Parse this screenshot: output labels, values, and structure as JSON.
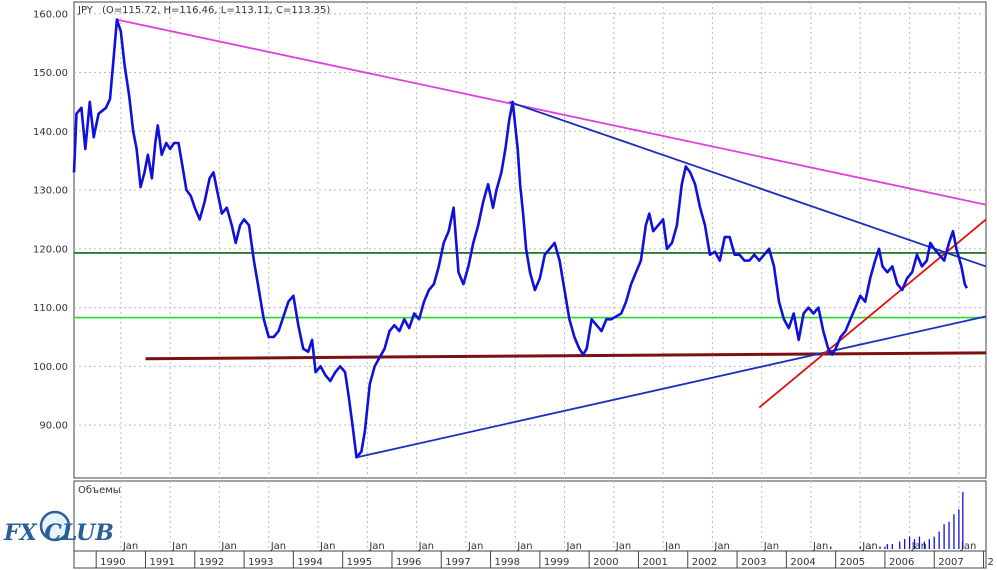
{
  "header": {
    "symbol": "JPY",
    "ohlc": "(O=115.72, H=116.46, L=113.11, C=113.35)"
  },
  "volume_panel": {
    "label": "Объемы"
  },
  "logo": {
    "text": "FX CLUB"
  },
  "colors": {
    "price": "#1010dd",
    "background": "#ffffff",
    "grid": "#bbbbbb",
    "magenta_trend": "#e040e0",
    "blue_trend": "#1a2fc0",
    "red_trend": "#dd1111",
    "dark_green_level": "#0a6a0a",
    "bright_green_level": "#22dd22",
    "maroon_level": "#7a1010"
  },
  "chart_data": {
    "type": "line",
    "title": "",
    "ylabel": "",
    "ylim": [
      81,
      162
    ],
    "xlim": [
      1989.55,
      2008.05
    ],
    "grid": true,
    "yticks": [
      "90.00",
      "100.00",
      "110.00",
      "120.00",
      "130.00",
      "140.00",
      "150.00",
      "160.00"
    ],
    "xticks_years": [
      "1990",
      "1991",
      "1992",
      "1993",
      "1994",
      "1995",
      "1996",
      "1997",
      "1998",
      "1999",
      "2000",
      "2001",
      "2002",
      "2003",
      "2004",
      "2005",
      "2006",
      "2007",
      "2"
    ],
    "xticks_months": [
      "Jan",
      "Jan",
      "Jan",
      "Jan",
      "Jan",
      "Jan",
      "Jan",
      "Jan",
      "Jan",
      "Jan",
      "Jan",
      "Jan",
      "Jan",
      "Jan",
      "Jan",
      "Jan",
      "Jan",
      "Jan"
    ],
    "series": [
      {
        "values": [
          [
            1989.55,
            133.0
          ],
          [
            1989.6,
            143.0
          ],
          [
            1989.7,
            144.0
          ],
          [
            1989.78,
            137.0
          ],
          [
            1989.87,
            145.0
          ],
          [
            1989.95,
            139.0
          ],
          [
            1990.05,
            143.0
          ],
          [
            1990.2,
            144.0
          ],
          [
            1990.28,
            145.5
          ],
          [
            1990.35,
            152.0
          ],
          [
            1990.42,
            159.0
          ],
          [
            1990.5,
            157.0
          ],
          [
            1990.58,
            151.0
          ],
          [
            1990.67,
            146.0
          ],
          [
            1990.75,
            140.0
          ],
          [
            1990.82,
            137.0
          ],
          [
            1990.9,
            130.5
          ],
          [
            1990.98,
            133.0
          ],
          [
            1991.05,
            136.0
          ],
          [
            1991.13,
            132.0
          ],
          [
            1991.2,
            138.0
          ],
          [
            1991.25,
            141.0
          ],
          [
            1991.33,
            136.0
          ],
          [
            1991.42,
            138.0
          ],
          [
            1991.5,
            137.0
          ],
          [
            1991.58,
            138.0
          ],
          [
            1991.67,
            138.0
          ],
          [
            1991.75,
            134.0
          ],
          [
            1991.83,
            130.0
          ],
          [
            1991.92,
            129.0
          ],
          [
            1992.0,
            127.0
          ],
          [
            1992.1,
            125.0
          ],
          [
            1992.2,
            128.0
          ],
          [
            1992.3,
            132.0
          ],
          [
            1992.38,
            133.0
          ],
          [
            1992.45,
            130.0
          ],
          [
            1992.55,
            126.0
          ],
          [
            1992.65,
            127.0
          ],
          [
            1992.75,
            124.0
          ],
          [
            1992.83,
            121.0
          ],
          [
            1992.92,
            124.0
          ],
          [
            1993.0,
            125.0
          ],
          [
            1993.1,
            124.0
          ],
          [
            1993.2,
            118.0
          ],
          [
            1993.3,
            113.0
          ],
          [
            1993.4,
            108.0
          ],
          [
            1993.5,
            105.0
          ],
          [
            1993.6,
            105.0
          ],
          [
            1993.7,
            106.0
          ],
          [
            1993.8,
            108.5
          ],
          [
            1993.9,
            111.0
          ],
          [
            1994.0,
            112.0
          ],
          [
            1994.1,
            107.0
          ],
          [
            1994.2,
            103.0
          ],
          [
            1994.3,
            102.5
          ],
          [
            1994.38,
            104.5
          ],
          [
            1994.45,
            99.0
          ],
          [
            1994.55,
            100.0
          ],
          [
            1994.65,
            98.5
          ],
          [
            1994.75,
            97.5
          ],
          [
            1994.85,
            99.0
          ],
          [
            1994.95,
            100.0
          ],
          [
            1995.05,
            99.0
          ],
          [
            1995.12,
            95.0
          ],
          [
            1995.2,
            90.0
          ],
          [
            1995.28,
            84.5
          ],
          [
            1995.38,
            85.5
          ],
          [
            1995.45,
            89.0
          ],
          [
            1995.55,
            97.0
          ],
          [
            1995.65,
            100.0
          ],
          [
            1995.75,
            101.5
          ],
          [
            1995.85,
            103.0
          ],
          [
            1995.95,
            106.0
          ],
          [
            1996.05,
            107.0
          ],
          [
            1996.15,
            106.0
          ],
          [
            1996.25,
            108.0
          ],
          [
            1996.35,
            106.5
          ],
          [
            1996.45,
            109.0
          ],
          [
            1996.55,
            108.0
          ],
          [
            1996.65,
            111.0
          ],
          [
            1996.75,
            113.0
          ],
          [
            1996.85,
            114.0
          ],
          [
            1996.95,
            117.0
          ],
          [
            1997.05,
            121.0
          ],
          [
            1997.15,
            123.0
          ],
          [
            1997.25,
            127.0
          ],
          [
            1997.35,
            116.0
          ],
          [
            1997.45,
            114.0
          ],
          [
            1997.55,
            117.0
          ],
          [
            1997.65,
            121.0
          ],
          [
            1997.75,
            124.0
          ],
          [
            1997.85,
            128.0
          ],
          [
            1997.95,
            131.0
          ],
          [
            1998.05,
            127.0
          ],
          [
            1998.12,
            130.0
          ],
          [
            1998.22,
            133.0
          ],
          [
            1998.3,
            137.0
          ],
          [
            1998.38,
            142.0
          ],
          [
            1998.45,
            145.0
          ],
          [
            1998.5,
            141.0
          ],
          [
            1998.55,
            137.0
          ],
          [
            1998.6,
            131.0
          ],
          [
            1998.66,
            126.0
          ],
          [
            1998.72,
            120.0
          ],
          [
            1998.8,
            116.0
          ],
          [
            1998.9,
            113.0
          ],
          [
            1999.0,
            115.0
          ],
          [
            1999.1,
            119.0
          ],
          [
            1999.2,
            120.0
          ],
          [
            1999.3,
            121.0
          ],
          [
            1999.4,
            118.0
          ],
          [
            1999.5,
            113.0
          ],
          [
            1999.6,
            108.0
          ],
          [
            1999.7,
            105.0
          ],
          [
            1999.8,
            103.0
          ],
          [
            1999.88,
            102.0
          ],
          [
            1999.95,
            103.0
          ],
          [
            2000.05,
            108.0
          ],
          [
            2000.15,
            107.0
          ],
          [
            2000.25,
            106.0
          ],
          [
            2000.35,
            108.0
          ],
          [
            2000.45,
            108.0
          ],
          [
            2000.55,
            108.5
          ],
          [
            2000.65,
            109.0
          ],
          [
            2000.75,
            111.0
          ],
          [
            2000.85,
            114.0
          ],
          [
            2000.95,
            116.0
          ],
          [
            2001.05,
            118.0
          ],
          [
            2001.15,
            124.0
          ],
          [
            2001.22,
            126.0
          ],
          [
            2001.3,
            123.0
          ],
          [
            2001.4,
            124.0
          ],
          [
            2001.5,
            125.0
          ],
          [
            2001.58,
            120.0
          ],
          [
            2001.68,
            121.0
          ],
          [
            2001.78,
            124.0
          ],
          [
            2001.88,
            131.0
          ],
          [
            2001.96,
            134.0
          ],
          [
            2002.05,
            133.0
          ],
          [
            2002.15,
            131.0
          ],
          [
            2002.25,
            127.0
          ],
          [
            2002.35,
            124.0
          ],
          [
            2002.45,
            119.0
          ],
          [
            2002.55,
            119.5
          ],
          [
            2002.65,
            118.0
          ],
          [
            2002.75,
            122.0
          ],
          [
            2002.85,
            122.0
          ],
          [
            2002.95,
            119.0
          ],
          [
            2003.05,
            119.0
          ],
          [
            2003.15,
            118.0
          ],
          [
            2003.25,
            118.0
          ],
          [
            2003.35,
            119.0
          ],
          [
            2003.45,
            118.0
          ],
          [
            2003.55,
            119.0
          ],
          [
            2003.65,
            120.0
          ],
          [
            2003.75,
            117.0
          ],
          [
            2003.85,
            111.0
          ],
          [
            2003.95,
            108.0
          ],
          [
            2004.05,
            106.5
          ],
          [
            2004.15,
            109.0
          ],
          [
            2004.25,
            104.5
          ],
          [
            2004.35,
            109.0
          ],
          [
            2004.45,
            110.0
          ],
          [
            2004.55,
            109.0
          ],
          [
            2004.65,
            110.0
          ],
          [
            2004.75,
            106.0
          ],
          [
            2004.85,
            103.0
          ],
          [
            2004.93,
            102.0
          ],
          [
            2005.0,
            103.0
          ],
          [
            2005.1,
            105.0
          ],
          [
            2005.2,
            106.0
          ],
          [
            2005.3,
            108.0
          ],
          [
            2005.4,
            110.0
          ],
          [
            2005.5,
            112.0
          ],
          [
            2005.6,
            111.0
          ],
          [
            2005.7,
            115.0
          ],
          [
            2005.8,
            118.0
          ],
          [
            2005.88,
            120.0
          ],
          [
            2005.95,
            117.0
          ],
          [
            2006.05,
            116.0
          ],
          [
            2006.15,
            117.0
          ],
          [
            2006.25,
            114.0
          ],
          [
            2006.35,
            113.0
          ],
          [
            2006.45,
            115.0
          ],
          [
            2006.55,
            116.0
          ],
          [
            2006.65,
            119.0
          ],
          [
            2006.75,
            117.0
          ],
          [
            2006.85,
            118.0
          ],
          [
            2006.92,
            121.0
          ],
          [
            2007.0,
            120.0
          ],
          [
            2007.1,
            119.0
          ],
          [
            2007.2,
            118.0
          ],
          [
            2007.3,
            121.0
          ],
          [
            2007.38,
            123.0
          ],
          [
            2007.45,
            120.0
          ],
          [
            2007.55,
            117.0
          ],
          [
            2007.62,
            114.0
          ],
          [
            2007.66,
            113.3
          ]
        ]
      }
    ],
    "trendlines": [
      {
        "role": "magenta_trend",
        "points": [
          [
            1990.42,
            159.0
          ],
          [
            2008.05,
            127.5
          ]
        ]
      },
      {
        "role": "blue_trend",
        "points": [
          [
            1998.38,
            145.0
          ],
          [
            2008.05,
            117.0
          ]
        ]
      },
      {
        "role": "blue_trend",
        "points": [
          [
            1995.28,
            84.5
          ],
          [
            2008.05,
            108.5
          ]
        ]
      },
      {
        "role": "red_trend",
        "points": [
          [
            2003.45,
            93.0
          ],
          [
            2008.05,
            125.0
          ]
        ]
      }
    ],
    "horizontal_levels": [
      {
        "role": "dark_green_level",
        "y": 119.3,
        "x_from": 1989.55
      },
      {
        "role": "bright_green_level",
        "y": 108.3,
        "x_from": 1989.55
      },
      {
        "role": "maroon_level",
        "y": 101.3,
        "x_from": 1991.0,
        "y_end": 102.3
      }
    ],
    "volume": {
      "bars": [
        [
          2004.9,
          1
        ],
        [
          2005.5,
          1
        ],
        [
          2005.7,
          1
        ],
        [
          2005.9,
          1
        ],
        [
          2006.0,
          1
        ],
        [
          2006.05,
          2
        ],
        [
          2006.15,
          2
        ],
        [
          2006.3,
          3
        ],
        [
          2006.4,
          4
        ],
        [
          2006.5,
          5
        ],
        [
          2006.6,
          4
        ],
        [
          2006.7,
          5
        ],
        [
          2006.8,
          3
        ],
        [
          2006.9,
          4
        ],
        [
          2007.0,
          5
        ],
        [
          2007.1,
          7
        ],
        [
          2007.2,
          10
        ],
        [
          2007.3,
          11
        ],
        [
          2007.4,
          14
        ],
        [
          2007.5,
          16
        ],
        [
          2007.58,
          23
        ]
      ]
    }
  }
}
